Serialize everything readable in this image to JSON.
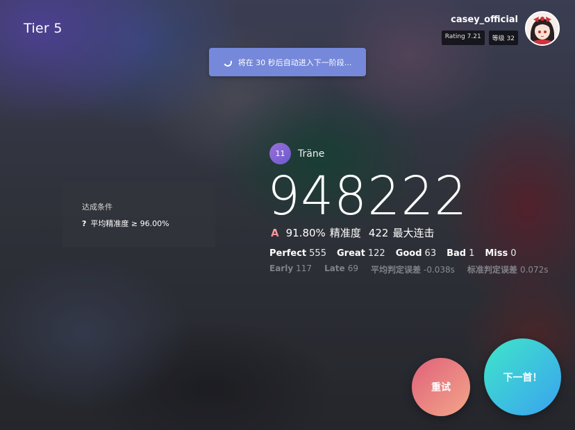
{
  "tier": "Tier 5",
  "profile": {
    "username": "casey_official",
    "rating": "Rating 7.21",
    "level": "等级 32"
  },
  "toast": {
    "text": "将在 30 秒后自动进入下一阶段..."
  },
  "requirement": {
    "title": "达成条件",
    "marker": "?",
    "item": "平均精准度 ≥ 96.00%"
  },
  "result": {
    "difficulty": "11",
    "song_title": "Träne",
    "score": "948222",
    "grade": "A",
    "accuracy": "91.80%",
    "accuracy_label": "精准度",
    "max_combo": "422",
    "max_combo_label": "最大连击",
    "judgements": [
      {
        "label": "Perfect",
        "value": "555"
      },
      {
        "label": "Great",
        "value": "122"
      },
      {
        "label": "Good",
        "value": "63"
      },
      {
        "label": "Bad",
        "value": "1"
      },
      {
        "label": "Miss",
        "value": "0"
      }
    ],
    "stats": [
      {
        "label": "Early",
        "value": "117"
      },
      {
        "label": "Late",
        "value": "69"
      },
      {
        "label": "平均判定误差",
        "value": "-0.038s"
      },
      {
        "label": "标准判定误差",
        "value": "0.072s"
      }
    ]
  },
  "buttons": {
    "retry": "重试",
    "next": "下一首！"
  },
  "colors": {
    "toast": "#788ce1",
    "retry_start": "#e0617a",
    "retry_end": "#f3a68a",
    "next_start": "#3fe6c9",
    "next_end": "#3aa2f0",
    "level_badge": "#7e65d3"
  }
}
